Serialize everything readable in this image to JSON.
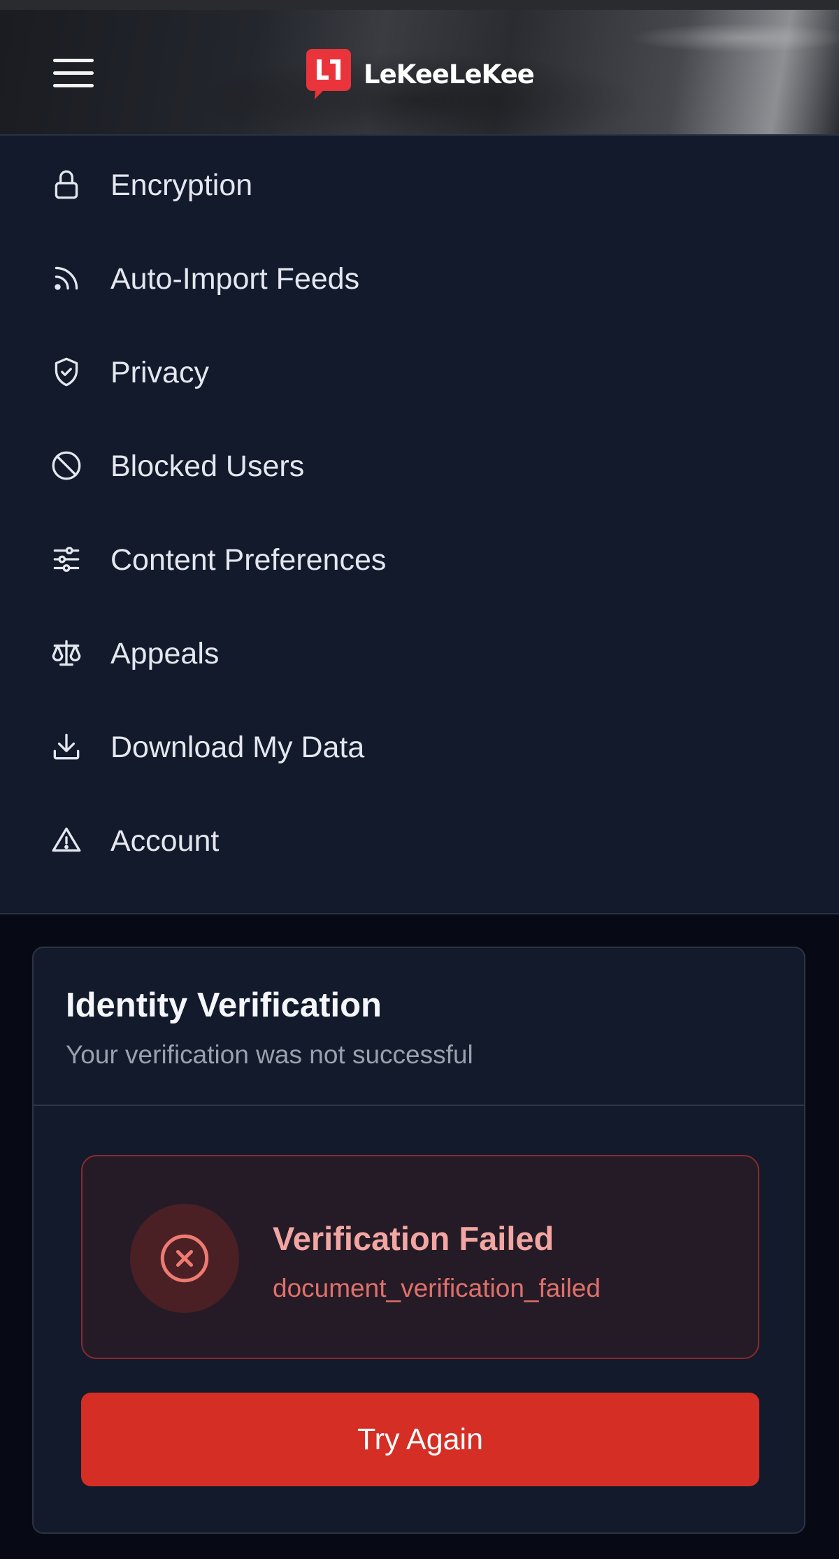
{
  "header": {
    "brand": "LeKeeLeKee",
    "logo_mark_text": "L1"
  },
  "menu": {
    "items": [
      {
        "label": "Encryption",
        "icon": "lock-icon"
      },
      {
        "label": "Auto-Import Feeds",
        "icon": "rss-icon"
      },
      {
        "label": "Privacy",
        "icon": "shield-check-icon"
      },
      {
        "label": "Blocked Users",
        "icon": "ban-icon"
      },
      {
        "label": "Content Preferences",
        "icon": "sliders-icon"
      },
      {
        "label": "Appeals",
        "icon": "scale-icon"
      },
      {
        "label": "Download My Data",
        "icon": "download-icon"
      },
      {
        "label": "Account",
        "icon": "warning-icon"
      }
    ]
  },
  "verification": {
    "title": "Identity Verification",
    "subtitle": "Your verification was not successful",
    "alert_title": "Verification Failed",
    "alert_code": "document_verification_failed",
    "alert_icon": "x-circle-icon",
    "button_label": "Try Again"
  },
  "colors": {
    "brand_red": "#e8343a",
    "button_red": "#d42e25",
    "menu_bg": "#121a2c",
    "page_bg": "#070a14",
    "alert_text": "#f2a6a2"
  }
}
